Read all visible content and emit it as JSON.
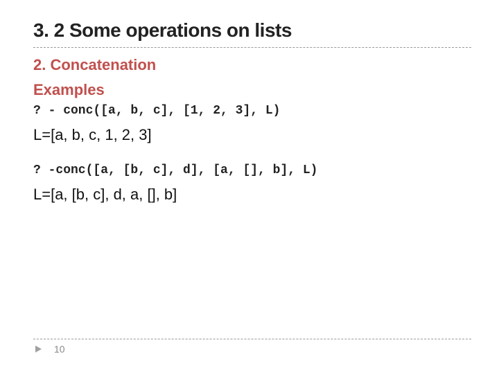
{
  "title": "3. 2 Some operations on lists",
  "subhead_line1": "2.   Concatenation",
  "subhead_line2": "Examples",
  "code1": "? -  conc([a, b, c], [1, 2, 3], L)",
  "result1": "L=[a, b, c, 1, 2, 3]",
  "code2": "? -conc([a, [b, c], d], [a, [], b], L)",
  "result2": "L=[a, [b, c], d, a, [], b]",
  "page_number": "10"
}
